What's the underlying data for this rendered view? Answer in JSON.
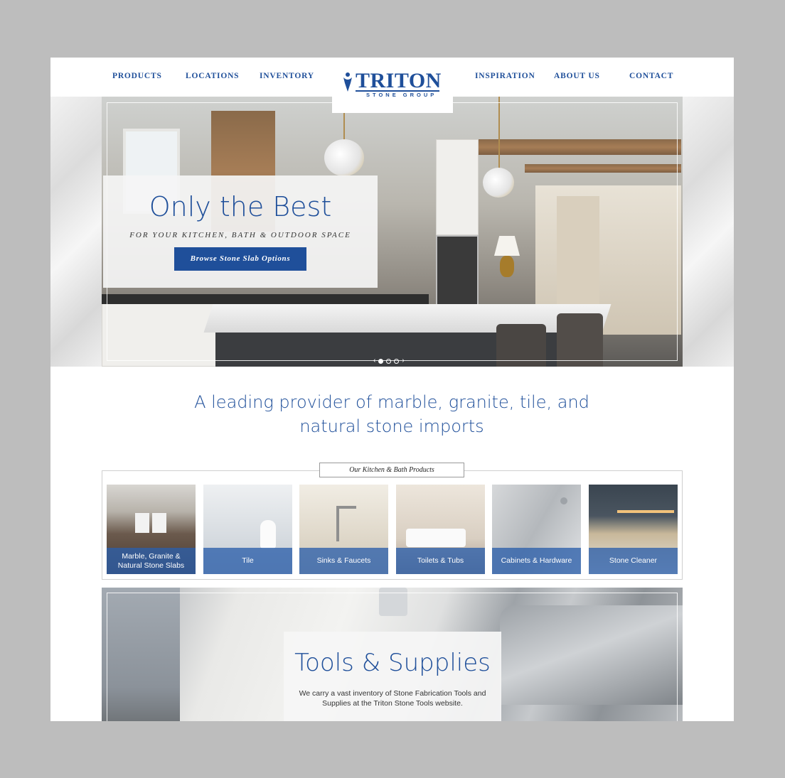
{
  "nav": {
    "left": [
      "PRODUCTS",
      "LOCATIONS",
      "INVENTORY"
    ],
    "right": [
      "INSPIRATION",
      "ABOUT US",
      "CONTACT"
    ]
  },
  "logo": {
    "main": "TRITON",
    "sub": "STONE GROUP",
    "icon": "trident-figure-icon"
  },
  "hero": {
    "title": "Only the Best",
    "subtitle": "FOR YOUR KITCHEN, BATH & OUTDOOR SPACE",
    "button": "Browse Stone Slab Options",
    "slides": 3,
    "active_slide": 1
  },
  "tagline": "A leading provider of marble, granite, tile, and natural stone imports",
  "products": {
    "label": "Our Kitchen & Bath Products",
    "items": [
      "Marble, Granite & Natural Stone Slabs",
      "Tile",
      "Sinks & Faucets",
      "Toilets & Tubs",
      "Cabinets & Hardware",
      "Stone Cleaner"
    ]
  },
  "tools": {
    "title": "Tools & Supplies",
    "text": "We carry a vast inventory of Stone Fabrication Tools and Supplies at the Triton Stone Tools website."
  },
  "colors": {
    "brand": "#1f4f9a",
    "caption_overlay": "#2c5faa",
    "background": "#bdbdbd"
  }
}
